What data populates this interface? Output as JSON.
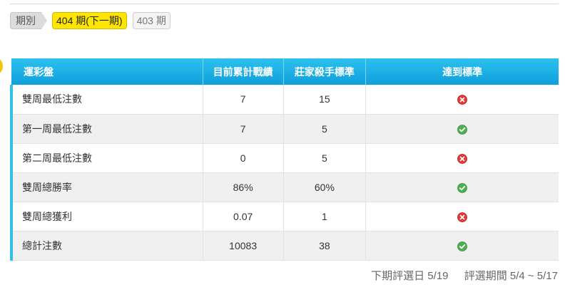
{
  "period": {
    "label": "期別",
    "current": "404 期(下一期)",
    "other": "403 期"
  },
  "table": {
    "headers": [
      "運彩盤",
      "目前累計戰績",
      "莊家殺手標準",
      "達到標準"
    ],
    "rows": [
      {
        "name": "雙周最低注數",
        "current": "7",
        "standard": "15",
        "met": false
      },
      {
        "name": "第一周最低注數",
        "current": "7",
        "standard": "5",
        "met": true
      },
      {
        "name": "第二周最低注數",
        "current": "0",
        "standard": "5",
        "met": false
      },
      {
        "name": "雙周總勝率",
        "current": "86%",
        "standard": "60%",
        "met": true
      },
      {
        "name": "雙周總獲利",
        "current": "0.07",
        "standard": "1",
        "met": false
      },
      {
        "name": "總計注數",
        "current": "10083",
        "standard": "38",
        "met": true
      }
    ]
  },
  "footer": {
    "next_review": "下期評選日 5/19",
    "review_period": "評選期間 5/4 ~ 5/17"
  },
  "icons": {
    "met": "check-circle-icon",
    "not_met": "cross-circle-icon"
  },
  "colors": {
    "accent": "#ffe600",
    "header": "#1aaee4",
    "success": "#4caf50",
    "fail": "#e53935"
  }
}
